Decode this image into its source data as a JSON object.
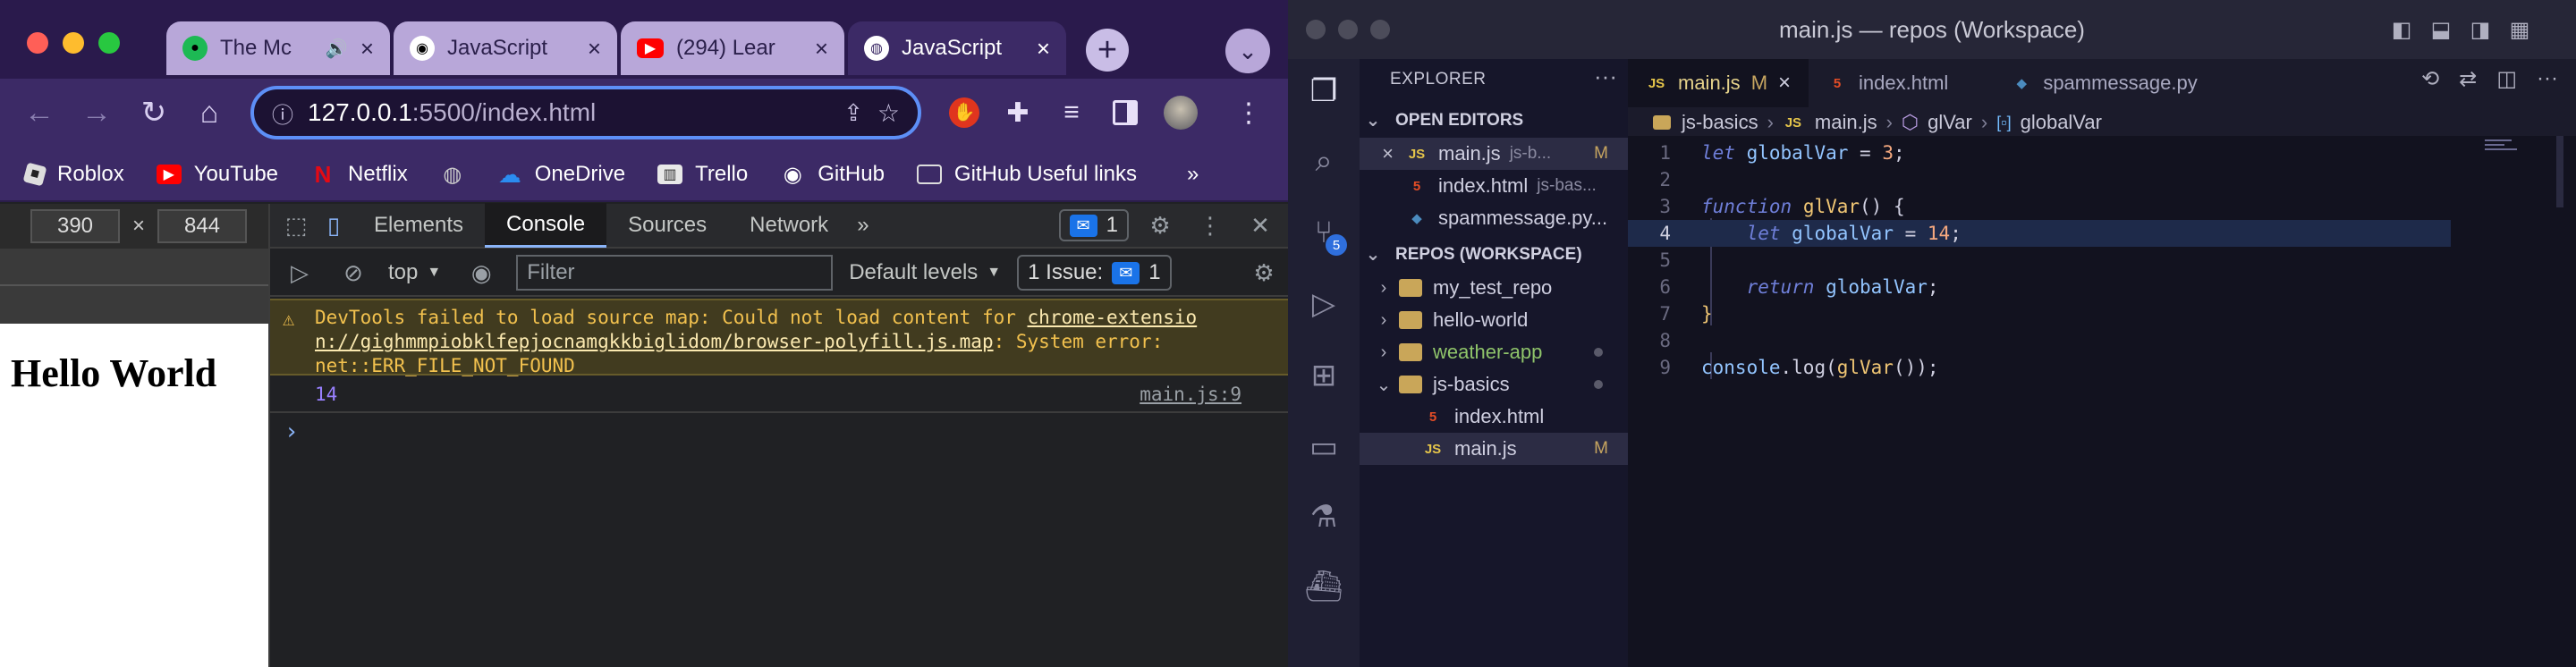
{
  "browser": {
    "tabs": [
      {
        "title": "The Mc",
        "icon": "spotify-icon",
        "color": "#1db954",
        "audio": true
      },
      {
        "title": "JavaScript",
        "icon": "github-icon",
        "color": "#ffffff"
      },
      {
        "title": "(294) Lear",
        "icon": "youtube-icon",
        "color": "#ff0000"
      },
      {
        "title": "JavaScript",
        "icon": "globe-icon",
        "color": "#ffffff",
        "active": true
      }
    ],
    "url_host": "127.0.0.1",
    "url_path": ":5500/index.html",
    "bookmarks": [
      "Roblox",
      "YouTube",
      "Netflix",
      "",
      "OneDrive",
      "Trello",
      "GitHub",
      "GitHub Useful links"
    ],
    "bookmarks_more": "»"
  },
  "device": {
    "width": "390",
    "height": "844",
    "times": "×"
  },
  "page": {
    "heading": "Hello World"
  },
  "devtools": {
    "tabs": [
      "Elements",
      "Console",
      "Sources",
      "Network"
    ],
    "more_tabs": "»",
    "msg_count": "1",
    "context": "top",
    "filter_placeholder": "Filter",
    "levels": "Default levels",
    "issues_label": "1 Issue:",
    "issues_count": "1",
    "warning_text_1": "DevTools failed to load source map: Could not load content for ",
    "warning_link_1": "chrome-extensio",
    "warning_link_2": "n://gighmmpiobklfepjocnamgkkbiglidom/browser-polyfill.js.map",
    "warning_text_2": ": System error:",
    "warning_text_3": "net::ERR_FILE_NOT_FOUND",
    "log_value": "14",
    "log_source": "main.js:9",
    "prompt": "›"
  },
  "vscode": {
    "title": "main.js — repos (Workspace)",
    "scm_badge": "5",
    "explorer_label": "EXPLORER",
    "explorer_more": "···",
    "open_editors_label": "OPEN EDITORS",
    "workspace_label": "REPOS (WORKSPACE)",
    "open_editors": [
      {
        "name": "main.js",
        "detail": "js-b...",
        "status": "M",
        "type": "js"
      },
      {
        "name": "index.html",
        "detail": "js-bas...",
        "type": "html"
      },
      {
        "name": "spammessage.py...",
        "detail": "",
        "type": "py"
      }
    ],
    "folders": [
      {
        "name": "my_test_repo"
      },
      {
        "name": "hello-world"
      },
      {
        "name": "weather-app"
      },
      {
        "name": "js-basics"
      }
    ],
    "js_basics_files": [
      {
        "name": "index.html",
        "type": "html"
      },
      {
        "name": "main.js",
        "type": "js",
        "status": "M"
      }
    ],
    "editor_tabs": [
      {
        "name": "main.js",
        "status": "M",
        "type": "js",
        "active": true
      },
      {
        "name": "index.html",
        "type": "html"
      },
      {
        "name": "spammessage.py",
        "type": "py"
      }
    ],
    "breadcrumb": [
      "js-basics",
      "main.js",
      "glVar",
      "globalVar"
    ],
    "code": {
      "l1": "1",
      "l2": "2",
      "l3": "3",
      "l4": "4",
      "l5": "5",
      "l6": "6",
      "l7": "7",
      "l8": "8",
      "l9": "9",
      "let1": "let",
      "var1": "globalVar",
      "eq1": " = ",
      "num1": "3",
      "semi": ";",
      "func": "function",
      "fname": "glVar",
      "fparen": "() {",
      "let2": "let",
      "var2": "globalVar",
      "eq2": " = ",
      "num2": "14",
      "semi2": ";",
      "ret": "return",
      "var3": "globalVar",
      "semi3": ";",
      "close": "}",
      "console": "console",
      "log": ".log(",
      "fcall": "glVar",
      "tail": "());"
    }
  }
}
